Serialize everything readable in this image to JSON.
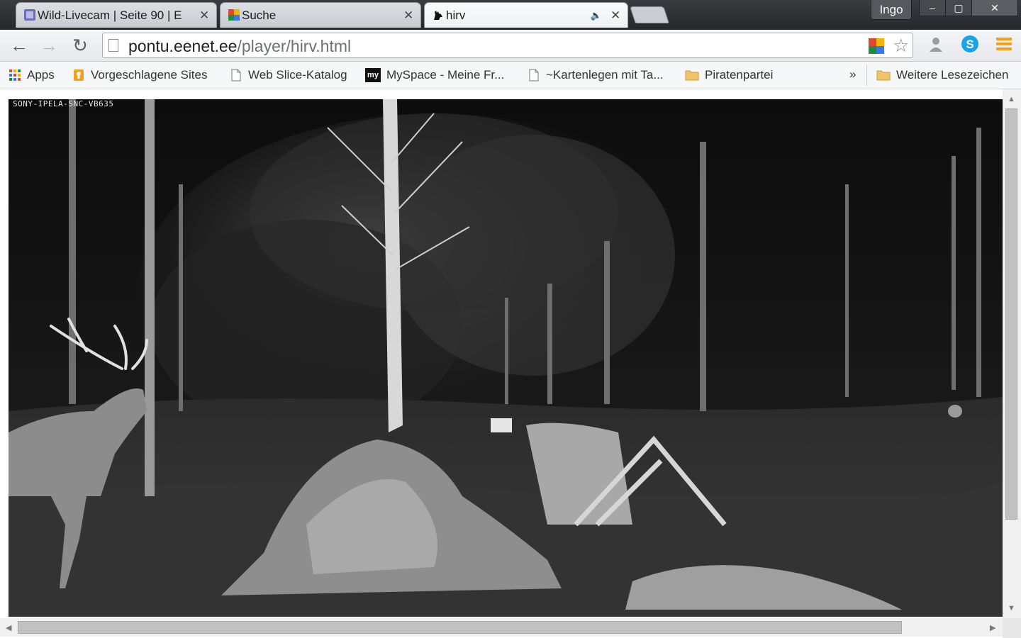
{
  "browser": {
    "tabs": [
      {
        "title": "Wild-Livecam | Seite 90 | E",
        "icon": "forum-favicon-icon",
        "active": false
      },
      {
        "title": "Suche",
        "icon": "search-favicon-icon",
        "active": false
      },
      {
        "title": "hirv",
        "icon": "deer-favicon-icon",
        "active": true,
        "audio": true
      }
    ],
    "close_glyph": "✕",
    "audio_glyph": "🔈",
    "profile_name": "Ingo",
    "window_controls": {
      "minimize": "–",
      "maximize": "▢",
      "close": "✕"
    }
  },
  "toolbar": {
    "back_glyph": "←",
    "forward_glyph": "→",
    "reload_glyph": "↻",
    "url_domain": "pontu.eenet.ee",
    "url_path": "/player/hirv.html",
    "star_glyph": "☆"
  },
  "bookmarks": {
    "items": [
      {
        "label": "Apps",
        "icon": "apps-grid-icon"
      },
      {
        "label": "Vorgeschlagene Sites",
        "icon": "suggested-sites-icon"
      },
      {
        "label": "Web Slice-Katalog",
        "icon": "page-icon"
      },
      {
        "label": "MySpace - Meine Fr...",
        "icon": "myspace-icon"
      },
      {
        "label": "~Kartenlegen mit Ta...",
        "icon": "page-icon"
      },
      {
        "label": "Piratenpartei",
        "icon": "folder-icon"
      }
    ],
    "more_glyph": "»",
    "other_label": "Weitere Lesezeichen",
    "myspace_badge": "my"
  },
  "video": {
    "camera_label": "SONY-IPELA-SNC-VB635"
  },
  "scrollbars": {
    "up": "▲",
    "down": "▼",
    "left": "◀",
    "right": "▶"
  },
  "colors": {
    "tabstrip": "#2e3034",
    "accent_orange": "#f4a01a",
    "skype_blue": "#1aa3e8"
  }
}
